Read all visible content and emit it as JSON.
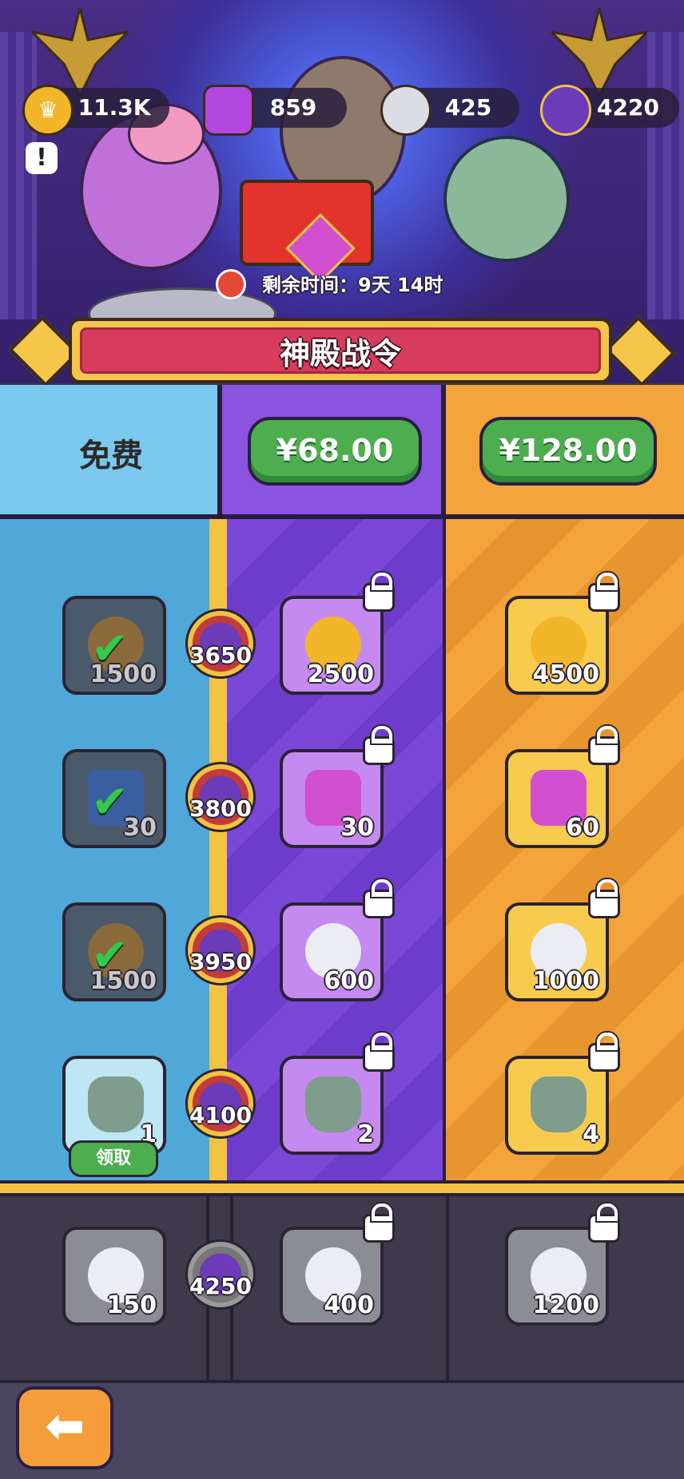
{
  "resources": [
    {
      "icon": "crown-coin-icon",
      "value": "11.3K",
      "color": "#f2b62a"
    },
    {
      "icon": "purple-gem-icon",
      "value": "859",
      "color": "#b348e0"
    },
    {
      "icon": "silver-token-icon",
      "value": "425",
      "color": "#dcdce6"
    },
    {
      "icon": "temple-token-icon",
      "value": "4220",
      "color": "#6b3bb8"
    }
  ],
  "timer": {
    "label": "剩余时间：9天 14时"
  },
  "title": "神殿战令",
  "columns": {
    "free": {
      "label": "免费"
    },
    "premium1": {
      "price": "¥68.00"
    },
    "premium2": {
      "price": "¥128.00"
    }
  },
  "rows": [
    {
      "level": "3650",
      "free": {
        "icon": "crown-coin-icon",
        "qty": "1500",
        "claimed": true
      },
      "p1": {
        "icon": "crown-coin-icon",
        "qty": "2500"
      },
      "p2": {
        "icon": "crown-coin-icon",
        "qty": "4500"
      }
    },
    {
      "level": "3800",
      "free": {
        "icon": "blue-ticket-icon",
        "qty": "30",
        "claimed": true
      },
      "p1": {
        "icon": "purple-gem-icon",
        "qty": "30"
      },
      "p2": {
        "icon": "purple-gem-icon",
        "qty": "60"
      }
    },
    {
      "level": "3950",
      "free": {
        "icon": "crown-coin-icon",
        "qty": "1500",
        "claimed": true
      },
      "p1": {
        "icon": "silver-token-icon",
        "qty": "600"
      },
      "p2": {
        "icon": "silver-token-icon",
        "qty": "1000"
      }
    },
    {
      "level": "4100",
      "free": {
        "icon": "goblin-hero-icon",
        "qty": "1",
        "claimed": false
      },
      "p1": {
        "icon": "goblin-hero-icon",
        "qty": "2"
      },
      "p2": {
        "icon": "goblin-hero-icon",
        "qty": "4"
      }
    },
    {
      "level": "4250",
      "free": {
        "icon": "silver-token-icon",
        "qty": "150"
      },
      "p1": {
        "icon": "silver-token-icon",
        "qty": "400"
      },
      "p2": {
        "icon": "silver-token-icon",
        "qty": "1200"
      }
    }
  ],
  "claim_label": "领取",
  "back_icon": "back-arrow-icon",
  "colors": {
    "free": "#4fa8d8",
    "premium1": "#7b47d6",
    "premium2": "#f3a43a",
    "claim": "#4cae4f"
  }
}
